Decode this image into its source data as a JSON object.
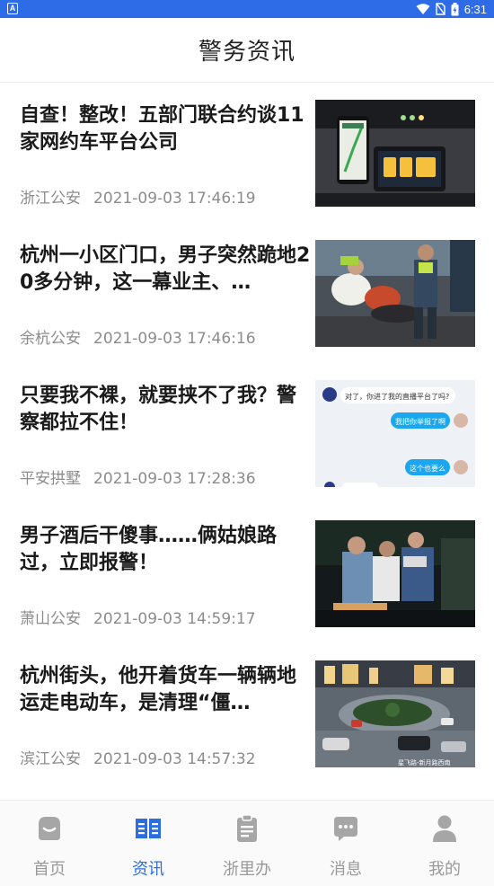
{
  "status_bar": {
    "app_badge": "A",
    "time": "6:31"
  },
  "header": {
    "title": "警务资讯"
  },
  "news": [
    {
      "title": "自查！整改！五部门联合约谈11家网约车平台公司",
      "source": "浙江公安",
      "time": "2021-09-03 17:46:19",
      "thumb_icon": "car-dashboard-navigation-photo"
    },
    {
      "title": "杭州一小区门口，男子突然跪地20多分钟，这一幕业主、…",
      "source": "余杭公安",
      "time": "2021-09-03 17:46:16",
      "thumb_icon": "police-helping-man-photo"
    },
    {
      "title": "只要我不裸，就要挟不了我？警察都拉不住！",
      "source": "平安拱墅",
      "time": "2021-09-03 17:28:36",
      "thumb_icon": "chat-screenshot-image",
      "thumb_chat": {
        "msg1": "对了，你进了我的直播平台了吗?",
        "msg2": "我把你举报了啊",
        "msg3": "这个也要么"
      }
    },
    {
      "title": "男子酒后干傻事……俩姑娘路过，立即报警！",
      "source": "萧山公安",
      "time": "2021-09-03 14:59:17",
      "thumb_icon": "night-police-scene-photo"
    },
    {
      "title": "杭州街头，他开着货车一辆辆地运走电动车，是清理“僵…",
      "source": "滨江公安",
      "time": "2021-09-03 14:57:32",
      "thumb_icon": "roundabout-traffic-camera-photo",
      "thumb_caption": "星飞路-新月路西南"
    }
  ],
  "tabs": [
    {
      "label": "首页",
      "icon": "home-icon",
      "active": false
    },
    {
      "label": "资讯",
      "icon": "news-icon",
      "active": true
    },
    {
      "label": "浙里办",
      "icon": "clipboard-icon",
      "active": false
    },
    {
      "label": "消息",
      "icon": "message-icon",
      "active": false
    },
    {
      "label": "我的",
      "icon": "profile-icon",
      "active": false
    }
  ],
  "colors": {
    "status_bar": "#2e6be6",
    "active_tab": "#2a6ee0",
    "inactive_tab": "#999999",
    "meta_text": "#8c8c8c"
  }
}
